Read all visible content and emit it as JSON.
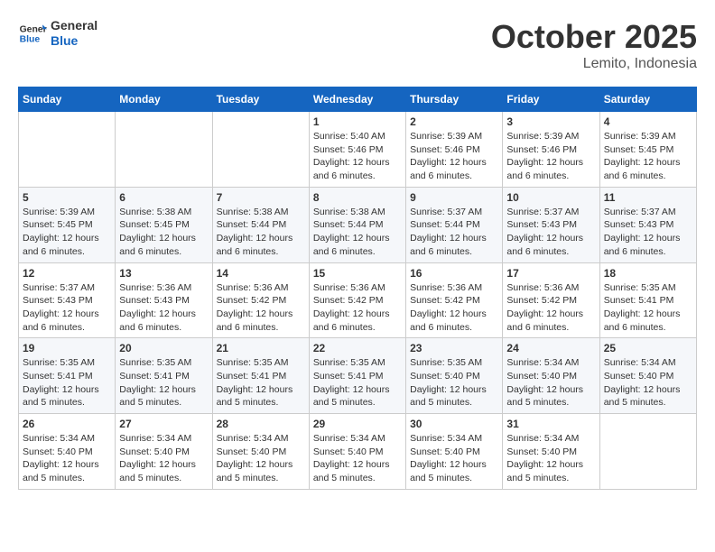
{
  "header": {
    "logo_general": "General",
    "logo_blue": "Blue",
    "month": "October 2025",
    "location": "Lemito, Indonesia"
  },
  "weekdays": [
    "Sunday",
    "Monday",
    "Tuesday",
    "Wednesday",
    "Thursday",
    "Friday",
    "Saturday"
  ],
  "weeks": [
    [
      {
        "day": "",
        "info": ""
      },
      {
        "day": "",
        "info": ""
      },
      {
        "day": "",
        "info": ""
      },
      {
        "day": "1",
        "info": "Sunrise: 5:40 AM\nSunset: 5:46 PM\nDaylight: 12 hours\nand 6 minutes."
      },
      {
        "day": "2",
        "info": "Sunrise: 5:39 AM\nSunset: 5:46 PM\nDaylight: 12 hours\nand 6 minutes."
      },
      {
        "day": "3",
        "info": "Sunrise: 5:39 AM\nSunset: 5:46 PM\nDaylight: 12 hours\nand 6 minutes."
      },
      {
        "day": "4",
        "info": "Sunrise: 5:39 AM\nSunset: 5:45 PM\nDaylight: 12 hours\nand 6 minutes."
      }
    ],
    [
      {
        "day": "5",
        "info": "Sunrise: 5:39 AM\nSunset: 5:45 PM\nDaylight: 12 hours\nand 6 minutes."
      },
      {
        "day": "6",
        "info": "Sunrise: 5:38 AM\nSunset: 5:45 PM\nDaylight: 12 hours\nand 6 minutes."
      },
      {
        "day": "7",
        "info": "Sunrise: 5:38 AM\nSunset: 5:44 PM\nDaylight: 12 hours\nand 6 minutes."
      },
      {
        "day": "8",
        "info": "Sunrise: 5:38 AM\nSunset: 5:44 PM\nDaylight: 12 hours\nand 6 minutes."
      },
      {
        "day": "9",
        "info": "Sunrise: 5:37 AM\nSunset: 5:44 PM\nDaylight: 12 hours\nand 6 minutes."
      },
      {
        "day": "10",
        "info": "Sunrise: 5:37 AM\nSunset: 5:43 PM\nDaylight: 12 hours\nand 6 minutes."
      },
      {
        "day": "11",
        "info": "Sunrise: 5:37 AM\nSunset: 5:43 PM\nDaylight: 12 hours\nand 6 minutes."
      }
    ],
    [
      {
        "day": "12",
        "info": "Sunrise: 5:37 AM\nSunset: 5:43 PM\nDaylight: 12 hours\nand 6 minutes."
      },
      {
        "day": "13",
        "info": "Sunrise: 5:36 AM\nSunset: 5:43 PM\nDaylight: 12 hours\nand 6 minutes."
      },
      {
        "day": "14",
        "info": "Sunrise: 5:36 AM\nSunset: 5:42 PM\nDaylight: 12 hours\nand 6 minutes."
      },
      {
        "day": "15",
        "info": "Sunrise: 5:36 AM\nSunset: 5:42 PM\nDaylight: 12 hours\nand 6 minutes."
      },
      {
        "day": "16",
        "info": "Sunrise: 5:36 AM\nSunset: 5:42 PM\nDaylight: 12 hours\nand 6 minutes."
      },
      {
        "day": "17",
        "info": "Sunrise: 5:36 AM\nSunset: 5:42 PM\nDaylight: 12 hours\nand 6 minutes."
      },
      {
        "day": "18",
        "info": "Sunrise: 5:35 AM\nSunset: 5:41 PM\nDaylight: 12 hours\nand 6 minutes."
      }
    ],
    [
      {
        "day": "19",
        "info": "Sunrise: 5:35 AM\nSunset: 5:41 PM\nDaylight: 12 hours\nand 5 minutes."
      },
      {
        "day": "20",
        "info": "Sunrise: 5:35 AM\nSunset: 5:41 PM\nDaylight: 12 hours\nand 5 minutes."
      },
      {
        "day": "21",
        "info": "Sunrise: 5:35 AM\nSunset: 5:41 PM\nDaylight: 12 hours\nand 5 minutes."
      },
      {
        "day": "22",
        "info": "Sunrise: 5:35 AM\nSunset: 5:41 PM\nDaylight: 12 hours\nand 5 minutes."
      },
      {
        "day": "23",
        "info": "Sunrise: 5:35 AM\nSunset: 5:40 PM\nDaylight: 12 hours\nand 5 minutes."
      },
      {
        "day": "24",
        "info": "Sunrise: 5:34 AM\nSunset: 5:40 PM\nDaylight: 12 hours\nand 5 minutes."
      },
      {
        "day": "25",
        "info": "Sunrise: 5:34 AM\nSunset: 5:40 PM\nDaylight: 12 hours\nand 5 minutes."
      }
    ],
    [
      {
        "day": "26",
        "info": "Sunrise: 5:34 AM\nSunset: 5:40 PM\nDaylight: 12 hours\nand 5 minutes."
      },
      {
        "day": "27",
        "info": "Sunrise: 5:34 AM\nSunset: 5:40 PM\nDaylight: 12 hours\nand 5 minutes."
      },
      {
        "day": "28",
        "info": "Sunrise: 5:34 AM\nSunset: 5:40 PM\nDaylight: 12 hours\nand 5 minutes."
      },
      {
        "day": "29",
        "info": "Sunrise: 5:34 AM\nSunset: 5:40 PM\nDaylight: 12 hours\nand 5 minutes."
      },
      {
        "day": "30",
        "info": "Sunrise: 5:34 AM\nSunset: 5:40 PM\nDaylight: 12 hours\nand 5 minutes."
      },
      {
        "day": "31",
        "info": "Sunrise: 5:34 AM\nSunset: 5:40 PM\nDaylight: 12 hours\nand 5 minutes."
      },
      {
        "day": "",
        "info": ""
      }
    ]
  ]
}
